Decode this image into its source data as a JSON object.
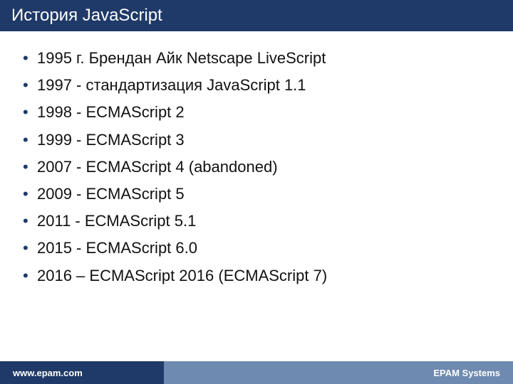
{
  "title": "История JavaScript",
  "items": [
    "1995 г. Брендан Айк Netscape LiveScript",
    "1997  - стандартизация JavaScript 1.1",
    "1998 - ECMAScript 2",
    "1999 - ECMAScript 3",
    "2007 - ECMAScript 4 (abandoned)",
    "2009 - ECMAScript 5",
    "2011 - ECMAScript 5.1",
    "2015 - ECMAScript 6.0",
    "2016 – ECMAScript 2016 (ECMAScript 7)"
  ],
  "footer": {
    "left": "www.epam.com",
    "right": "EPAM Systems"
  }
}
